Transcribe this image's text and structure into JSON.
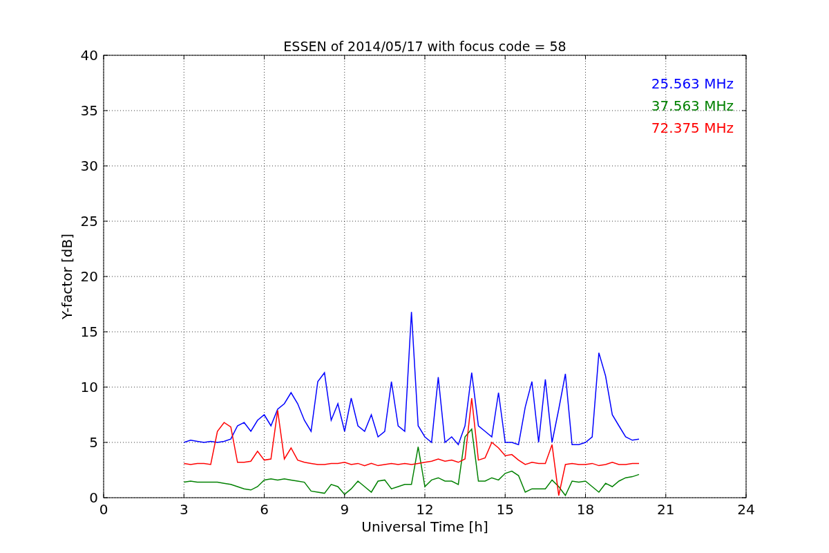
{
  "chart_data": {
    "type": "line",
    "title": "ESSEN of 2014/05/17 with focus code = 58",
    "xlabel": "Universal Time [h]",
    "ylabel": "Y-factor [dB]",
    "x": [
      3,
      3.25,
      3.5,
      3.75,
      4,
      4.25,
      4.5,
      4.75,
      5,
      5.25,
      5.5,
      5.75,
      6,
      6.25,
      6.5,
      6.75,
      7,
      7.25,
      7.5,
      7.75,
      8,
      8.25,
      8.5,
      8.75,
      9,
      9.25,
      9.5,
      9.75,
      10,
      10.25,
      10.5,
      10.75,
      11,
      11.25,
      11.5,
      11.75,
      12,
      12.25,
      12.5,
      12.75,
      13,
      13.25,
      13.5,
      13.75,
      14,
      14.25,
      14.5,
      14.75,
      15,
      15.25,
      15.5,
      15.75,
      16,
      16.25,
      16.5,
      16.75,
      17,
      17.25,
      17.5,
      17.75,
      18,
      18.25,
      18.5,
      18.75,
      19,
      19.25,
      19.5,
      19.75,
      20
    ],
    "series": [
      {
        "name": "25.563 MHz",
        "color": "#0000ff",
        "values": [
          5.0,
          5.2,
          5.1,
          5.0,
          5.1,
          5.0,
          5.1,
          5.3,
          6.5,
          6.8,
          6.0,
          7.0,
          7.5,
          6.5,
          8.0,
          8.5,
          9.5,
          8.5,
          7.0,
          6.0,
          10.5,
          11.3,
          7.0,
          8.5,
          6.0,
          9.0,
          6.5,
          6.0,
          7.5,
          5.5,
          6.0,
          10.5,
          6.5,
          6.0,
          16.8,
          6.5,
          5.5,
          5.0,
          10.9,
          5.0,
          5.5,
          4.8,
          6.5,
          11.3,
          6.5,
          6.0,
          5.5,
          9.5,
          5.0,
          5.0,
          4.8,
          8.2,
          10.5,
          5.0,
          10.7,
          5.0,
          8.0,
          11.2,
          4.8,
          4.8,
          5.0,
          5.5,
          13.1,
          11.0,
          7.5,
          6.5,
          5.5,
          5.2,
          5.3
        ]
      },
      {
        "name": "37.563 MHz",
        "color": "#008000",
        "values": [
          1.4,
          1.5,
          1.4,
          1.4,
          1.4,
          1.4,
          1.3,
          1.2,
          1.0,
          0.8,
          0.7,
          1.0,
          1.6,
          1.7,
          1.6,
          1.7,
          1.6,
          1.5,
          1.4,
          0.6,
          0.5,
          0.4,
          1.2,
          1.0,
          0.3,
          0.8,
          1.5,
          1.0,
          0.5,
          1.5,
          1.6,
          0.8,
          1.0,
          1.2,
          1.2,
          4.6,
          1.0,
          1.6,
          1.8,
          1.5,
          1.5,
          1.2,
          5.5,
          6.2,
          1.5,
          1.5,
          1.8,
          1.6,
          2.2,
          2.4,
          2.0,
          0.5,
          0.8,
          0.8,
          0.8,
          1.6,
          1.0,
          0.2,
          1.5,
          1.4,
          1.5,
          1.0,
          0.5,
          1.3,
          1.0,
          1.5,
          1.8,
          1.9,
          2.1
        ]
      },
      {
        "name": "72.375 MHz",
        "color": "#ff0000",
        "values": [
          3.1,
          3.0,
          3.1,
          3.1,
          3.0,
          6.0,
          6.8,
          6.4,
          3.2,
          3.2,
          3.3,
          4.2,
          3.4,
          3.5,
          7.9,
          3.5,
          4.5,
          3.4,
          3.2,
          3.1,
          3.0,
          3.0,
          3.1,
          3.1,
          3.2,
          3.0,
          3.1,
          2.9,
          3.1,
          2.9,
          3.0,
          3.1,
          3.0,
          3.1,
          3.0,
          3.1,
          3.2,
          3.3,
          3.5,
          3.3,
          3.4,
          3.2,
          3.5,
          9.0,
          3.4,
          3.6,
          5.0,
          4.5,
          3.8,
          3.9,
          3.4,
          3.0,
          3.2,
          3.1,
          3.1,
          4.8,
          0.2,
          3.0,
          3.1,
          3.0,
          3.0,
          3.1,
          2.9,
          3.0,
          3.2,
          3.0,
          3.0,
          3.1,
          3.1
        ]
      }
    ],
    "xlim": [
      0,
      24
    ],
    "ylim": [
      0,
      40
    ],
    "xticks": [
      0,
      3,
      6,
      9,
      12,
      15,
      18,
      21,
      24
    ],
    "yticks": [
      0,
      5,
      10,
      15,
      20,
      25,
      30,
      35,
      40
    ],
    "grid": true
  }
}
